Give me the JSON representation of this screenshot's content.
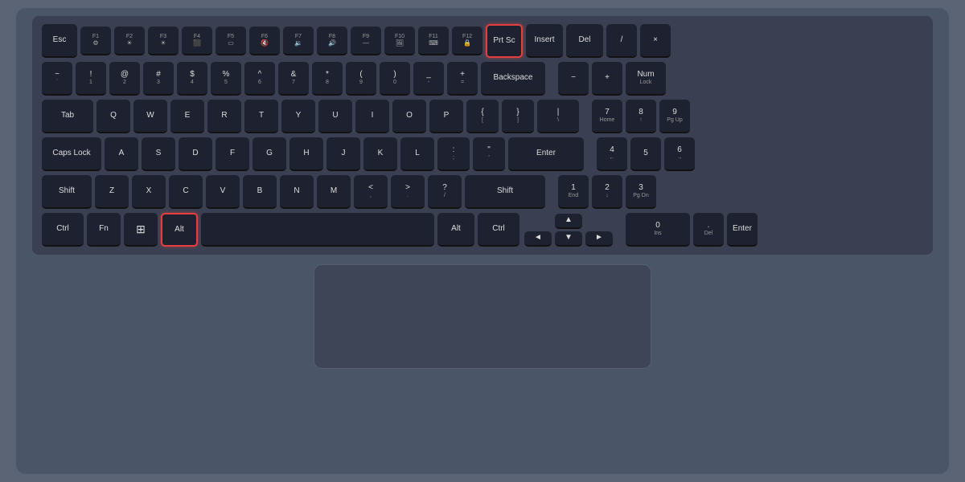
{
  "keyboard": {
    "rows": {
      "frow": {
        "keys": [
          "Esc",
          "F1",
          "F2",
          "F3",
          "F4",
          "F5",
          "F6",
          "F7",
          "F8",
          "F9",
          "F10",
          "F11",
          "F12",
          "Prt Sc",
          "Insert",
          "Del",
          "/",
          "×"
        ]
      }
    },
    "highlighted": {
      "prtsc": "Prt Sc",
      "alt": "Alt"
    }
  },
  "trackpad": {
    "label": "Trackpad"
  }
}
